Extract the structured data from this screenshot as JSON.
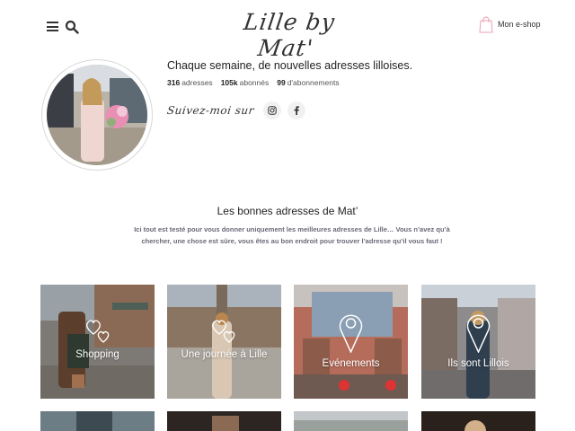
{
  "header": {
    "logo": "Lille by Mat'",
    "eshop_label": "Mon e-shop",
    "icons": [
      "menu-icon",
      "search-icon",
      "shopping-bag-icon"
    ]
  },
  "profile": {
    "tagline": "Chaque semaine, de nouvelles adresses lilloises.",
    "stats": [
      {
        "value": "316",
        "label": "adresses"
      },
      {
        "value": "105k",
        "label": "abonnés"
      },
      {
        "value": "99",
        "label": "d'abonnements"
      }
    ],
    "follow_label": "Suivez-moi sur",
    "social_icons": [
      "instagram-icon",
      "facebook-icon"
    ]
  },
  "section": {
    "title": "Les bonnes adresses de Mat’",
    "description": "Ici tout est testé pour vous donner uniquement les meilleures adresses de Lille… Vous n’avez qu’à chercher, une chose est sûre, vous êtes au bon endroit pour trouver l’adresse qu’il vous faut !"
  },
  "tiles": [
    {
      "label": "Shopping",
      "icon": "hearts-icon"
    },
    {
      "label": "Une journée à Lille",
      "icon": "hearts-icon"
    },
    {
      "label": "Evénements",
      "icon": "map-pin-icon"
    },
    {
      "label": "Ils sont Lillois",
      "icon": "map-pin-icon"
    }
  ],
  "colors": {
    "text": "#222222",
    "muted": "#6a6a7a",
    "bag_accent": "#e8a0b4"
  }
}
